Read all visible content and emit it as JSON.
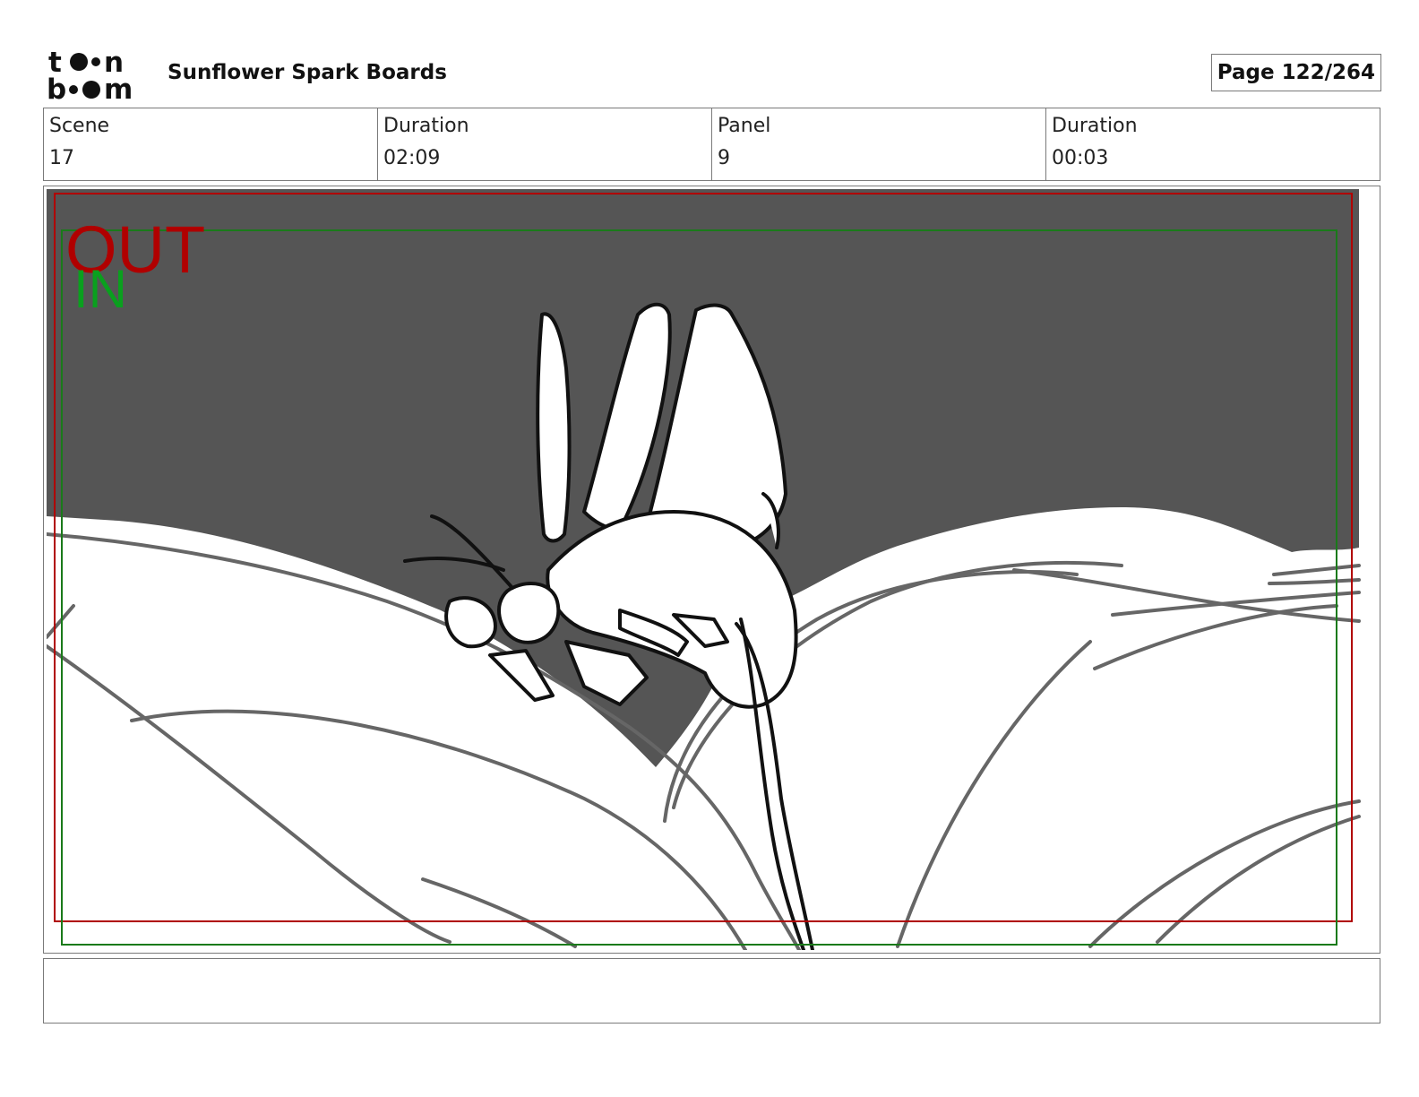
{
  "header": {
    "logo_text": "toon boom",
    "title": "Sunflower Spark Boards",
    "page_indicator": "Page 122/264"
  },
  "info": {
    "scene_label": "Scene",
    "scene_value": "17",
    "scene_duration_label": "Duration",
    "scene_duration_value": "02:09",
    "panel_label": "Panel",
    "panel_value": "9",
    "panel_duration_label": "Duration",
    "panel_duration_value": "00:03"
  },
  "panel": {
    "out_label": "OUT",
    "in_label": "IN",
    "sky_color": "#555555",
    "out_frame_color": "#b00000",
    "in_frame_color": "#1a7a1a"
  },
  "caption": {
    "text": ""
  }
}
